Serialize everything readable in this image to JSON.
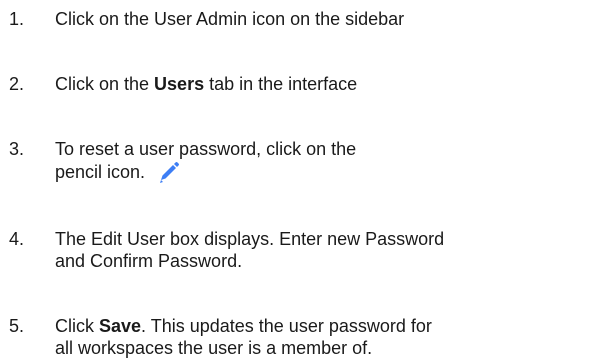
{
  "steps": [
    {
      "number": "1.",
      "parts": [
        "Click on the User Admin icon on the sidebar"
      ]
    },
    {
      "number": "2.",
      "before": "Click on the ",
      "bold": "Users",
      "after": " tab in the interface"
    },
    {
      "number": "3.",
      "line1": "To reset a user password, click on the",
      "line2": "pencil icon.",
      "icon": "pencil-icon",
      "icon_color": "#3d7ef5"
    },
    {
      "number": "4.",
      "line1": "The Edit User box displays. Enter new Password",
      "line2": "and Confirm Password."
    },
    {
      "number": "5.",
      "before": "Click ",
      "bold": "Save",
      "after": ". This updates the user password for",
      "line2": "all workspaces the user is a member of."
    }
  ]
}
